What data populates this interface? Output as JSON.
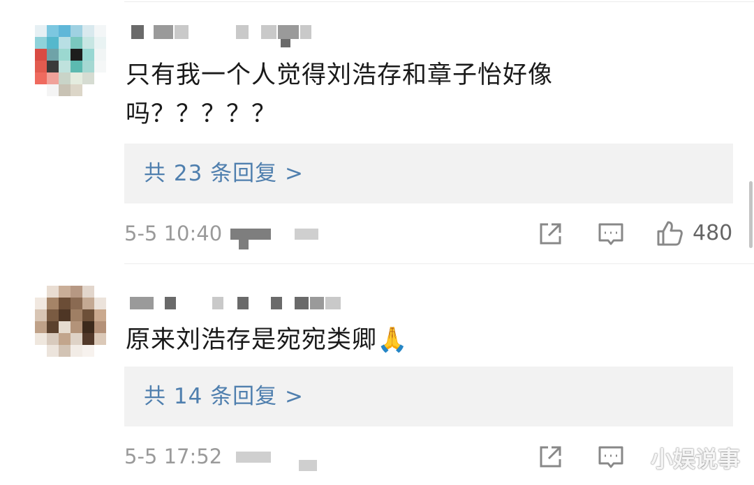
{
  "comments": [
    {
      "text": "只有我一个人觉得刘浩存和章子怡好像吗？？？？？",
      "reply_link": "共 23 条回复 >",
      "time": "5-5 10:40",
      "likes": "480"
    },
    {
      "text": "原来刘浩存是宛宛类卿🙏",
      "reply_link": "共 14 条回复 >",
      "time": "5-5 17:52"
    }
  ],
  "watermark": "小娱说事",
  "icons": {
    "share": "share-icon",
    "comment": "comment-icon",
    "like": "thumbs-up-icon"
  },
  "colors": {
    "reply_link": "#4f7fae",
    "reply_bg": "#f2f2f2",
    "meta": "#9a9a9a"
  }
}
